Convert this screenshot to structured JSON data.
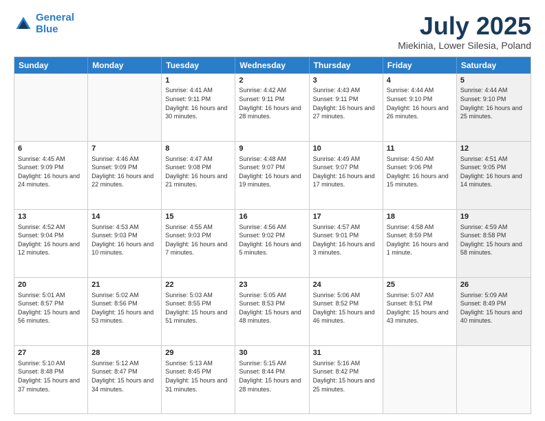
{
  "logo": {
    "line1": "General",
    "line2": "Blue"
  },
  "title": "July 2025",
  "subtitle": "Miekinia, Lower Silesia, Poland",
  "days": [
    "Sunday",
    "Monday",
    "Tuesday",
    "Wednesday",
    "Thursday",
    "Friday",
    "Saturday"
  ],
  "weeks": [
    [
      {
        "day": "",
        "sunrise": "",
        "sunset": "",
        "daylight": "",
        "shaded": false,
        "empty": true
      },
      {
        "day": "",
        "sunrise": "",
        "sunset": "",
        "daylight": "",
        "shaded": false,
        "empty": true
      },
      {
        "day": "1",
        "sunrise": "Sunrise: 4:41 AM",
        "sunset": "Sunset: 9:11 PM",
        "daylight": "Daylight: 16 hours and 30 minutes.",
        "shaded": false,
        "empty": false
      },
      {
        "day": "2",
        "sunrise": "Sunrise: 4:42 AM",
        "sunset": "Sunset: 9:11 PM",
        "daylight": "Daylight: 16 hours and 28 minutes.",
        "shaded": false,
        "empty": false
      },
      {
        "day": "3",
        "sunrise": "Sunrise: 4:43 AM",
        "sunset": "Sunset: 9:11 PM",
        "daylight": "Daylight: 16 hours and 27 minutes.",
        "shaded": false,
        "empty": false
      },
      {
        "day": "4",
        "sunrise": "Sunrise: 4:44 AM",
        "sunset": "Sunset: 9:10 PM",
        "daylight": "Daylight: 16 hours and 26 minutes.",
        "shaded": false,
        "empty": false
      },
      {
        "day": "5",
        "sunrise": "Sunrise: 4:44 AM",
        "sunset": "Sunset: 9:10 PM",
        "daylight": "Daylight: 16 hours and 25 minutes.",
        "shaded": true,
        "empty": false
      }
    ],
    [
      {
        "day": "6",
        "sunrise": "Sunrise: 4:45 AM",
        "sunset": "Sunset: 9:09 PM",
        "daylight": "Daylight: 16 hours and 24 minutes.",
        "shaded": false,
        "empty": false
      },
      {
        "day": "7",
        "sunrise": "Sunrise: 4:46 AM",
        "sunset": "Sunset: 9:09 PM",
        "daylight": "Daylight: 16 hours and 22 minutes.",
        "shaded": false,
        "empty": false
      },
      {
        "day": "8",
        "sunrise": "Sunrise: 4:47 AM",
        "sunset": "Sunset: 9:08 PM",
        "daylight": "Daylight: 16 hours and 21 minutes.",
        "shaded": false,
        "empty": false
      },
      {
        "day": "9",
        "sunrise": "Sunrise: 4:48 AM",
        "sunset": "Sunset: 9:07 PM",
        "daylight": "Daylight: 16 hours and 19 minutes.",
        "shaded": false,
        "empty": false
      },
      {
        "day": "10",
        "sunrise": "Sunrise: 4:49 AM",
        "sunset": "Sunset: 9:07 PM",
        "daylight": "Daylight: 16 hours and 17 minutes.",
        "shaded": false,
        "empty": false
      },
      {
        "day": "11",
        "sunrise": "Sunrise: 4:50 AM",
        "sunset": "Sunset: 9:06 PM",
        "daylight": "Daylight: 16 hours and 15 minutes.",
        "shaded": false,
        "empty": false
      },
      {
        "day": "12",
        "sunrise": "Sunrise: 4:51 AM",
        "sunset": "Sunset: 9:05 PM",
        "daylight": "Daylight: 16 hours and 14 minutes.",
        "shaded": true,
        "empty": false
      }
    ],
    [
      {
        "day": "13",
        "sunrise": "Sunrise: 4:52 AM",
        "sunset": "Sunset: 9:04 PM",
        "daylight": "Daylight: 16 hours and 12 minutes.",
        "shaded": false,
        "empty": false
      },
      {
        "day": "14",
        "sunrise": "Sunrise: 4:53 AM",
        "sunset": "Sunset: 9:03 PM",
        "daylight": "Daylight: 16 hours and 10 minutes.",
        "shaded": false,
        "empty": false
      },
      {
        "day": "15",
        "sunrise": "Sunrise: 4:55 AM",
        "sunset": "Sunset: 9:03 PM",
        "daylight": "Daylight: 16 hours and 7 minutes.",
        "shaded": false,
        "empty": false
      },
      {
        "day": "16",
        "sunrise": "Sunrise: 4:56 AM",
        "sunset": "Sunset: 9:02 PM",
        "daylight": "Daylight: 16 hours and 5 minutes.",
        "shaded": false,
        "empty": false
      },
      {
        "day": "17",
        "sunrise": "Sunrise: 4:57 AM",
        "sunset": "Sunset: 9:01 PM",
        "daylight": "Daylight: 16 hours and 3 minutes.",
        "shaded": false,
        "empty": false
      },
      {
        "day": "18",
        "sunrise": "Sunrise: 4:58 AM",
        "sunset": "Sunset: 8:59 PM",
        "daylight": "Daylight: 16 hours and 1 minute.",
        "shaded": false,
        "empty": false
      },
      {
        "day": "19",
        "sunrise": "Sunrise: 4:59 AM",
        "sunset": "Sunset: 8:58 PM",
        "daylight": "Daylight: 15 hours and 58 minutes.",
        "shaded": true,
        "empty": false
      }
    ],
    [
      {
        "day": "20",
        "sunrise": "Sunrise: 5:01 AM",
        "sunset": "Sunset: 8:57 PM",
        "daylight": "Daylight: 15 hours and 56 minutes.",
        "shaded": false,
        "empty": false
      },
      {
        "day": "21",
        "sunrise": "Sunrise: 5:02 AM",
        "sunset": "Sunset: 8:56 PM",
        "daylight": "Daylight: 15 hours and 53 minutes.",
        "shaded": false,
        "empty": false
      },
      {
        "day": "22",
        "sunrise": "Sunrise: 5:03 AM",
        "sunset": "Sunset: 8:55 PM",
        "daylight": "Daylight: 15 hours and 51 minutes.",
        "shaded": false,
        "empty": false
      },
      {
        "day": "23",
        "sunrise": "Sunrise: 5:05 AM",
        "sunset": "Sunset: 8:53 PM",
        "daylight": "Daylight: 15 hours and 48 minutes.",
        "shaded": false,
        "empty": false
      },
      {
        "day": "24",
        "sunrise": "Sunrise: 5:06 AM",
        "sunset": "Sunset: 8:52 PM",
        "daylight": "Daylight: 15 hours and 46 minutes.",
        "shaded": false,
        "empty": false
      },
      {
        "day": "25",
        "sunrise": "Sunrise: 5:07 AM",
        "sunset": "Sunset: 8:51 PM",
        "daylight": "Daylight: 15 hours and 43 minutes.",
        "shaded": false,
        "empty": false
      },
      {
        "day": "26",
        "sunrise": "Sunrise: 5:09 AM",
        "sunset": "Sunset: 8:49 PM",
        "daylight": "Daylight: 15 hours and 40 minutes.",
        "shaded": true,
        "empty": false
      }
    ],
    [
      {
        "day": "27",
        "sunrise": "Sunrise: 5:10 AM",
        "sunset": "Sunset: 8:48 PM",
        "daylight": "Daylight: 15 hours and 37 minutes.",
        "shaded": false,
        "empty": false
      },
      {
        "day": "28",
        "sunrise": "Sunrise: 5:12 AM",
        "sunset": "Sunset: 8:47 PM",
        "daylight": "Daylight: 15 hours and 34 minutes.",
        "shaded": false,
        "empty": false
      },
      {
        "day": "29",
        "sunrise": "Sunrise: 5:13 AM",
        "sunset": "Sunset: 8:45 PM",
        "daylight": "Daylight: 15 hours and 31 minutes.",
        "shaded": false,
        "empty": false
      },
      {
        "day": "30",
        "sunrise": "Sunrise: 5:15 AM",
        "sunset": "Sunset: 8:44 PM",
        "daylight": "Daylight: 15 hours and 28 minutes.",
        "shaded": false,
        "empty": false
      },
      {
        "day": "31",
        "sunrise": "Sunrise: 5:16 AM",
        "sunset": "Sunset: 8:42 PM",
        "daylight": "Daylight: 15 hours and 25 minutes.",
        "shaded": false,
        "empty": false
      },
      {
        "day": "",
        "sunrise": "",
        "sunset": "",
        "daylight": "",
        "shaded": false,
        "empty": true
      },
      {
        "day": "",
        "sunrise": "",
        "sunset": "",
        "daylight": "",
        "shaded": true,
        "empty": true
      }
    ]
  ]
}
